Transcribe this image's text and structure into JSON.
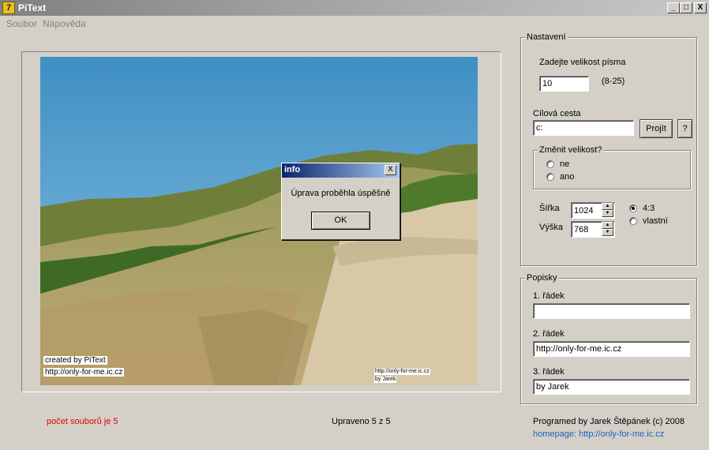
{
  "window": {
    "title": "PiText",
    "icon_glyph": "7",
    "controls": {
      "minimize": "_",
      "maximize": "□",
      "close": "X"
    }
  },
  "menu": {
    "items": [
      "Soubor",
      "Nápověda"
    ]
  },
  "image": {
    "caption_line1": "created by PiText",
    "caption_line2": "http://only-for-me.ic.cz",
    "mini_caption_line1": "http://only-for-me.ic.cz",
    "mini_caption_line2": "by Jarek"
  },
  "dialog": {
    "title": "info",
    "message": "Úprava proběhla úspěšně",
    "ok_label": "OK",
    "close_glyph": "X"
  },
  "settings": {
    "group_label": "Nastavení",
    "font_size_label": "Zadejte velikost písma",
    "font_size_value": "10",
    "font_size_range": "(8-25)",
    "target_path_label": "Cílová cesta",
    "target_path_value": "c:",
    "browse_label": "Projít",
    "help_label": "?",
    "resize": {
      "group_label": "Změnit velikost?",
      "options": [
        "ne",
        "ano"
      ]
    },
    "width_label": "Šířka",
    "width_value": "1024",
    "height_label": "Výška",
    "height_value": "768",
    "aspect_options": [
      "4:3",
      "vlastní"
    ],
    "aspect_selected": "4:3"
  },
  "captions": {
    "group_label": "Popisky",
    "line1_label": "1. řádek",
    "line1_value": "",
    "line2_label": "2. řádek",
    "line2_value": "http://only-for-me.ic.cz",
    "line3_label": "3. řádek",
    "line3_value": "by Jarek"
  },
  "footer": {
    "file_count": "počet souborů je 5",
    "status": "Upraveno 5 z 5",
    "author": "Programed by Jarek Štěpánek (c) 2008",
    "homepage": "homepage: http://only-for-me.ic.cz"
  },
  "colors": {
    "window_bg": "#d4d0c8",
    "dialog_title_start": "#0a246a",
    "dialog_title_end": "#a6caf0",
    "file_count_color": "#e00000",
    "link_color": "#2060c0"
  }
}
